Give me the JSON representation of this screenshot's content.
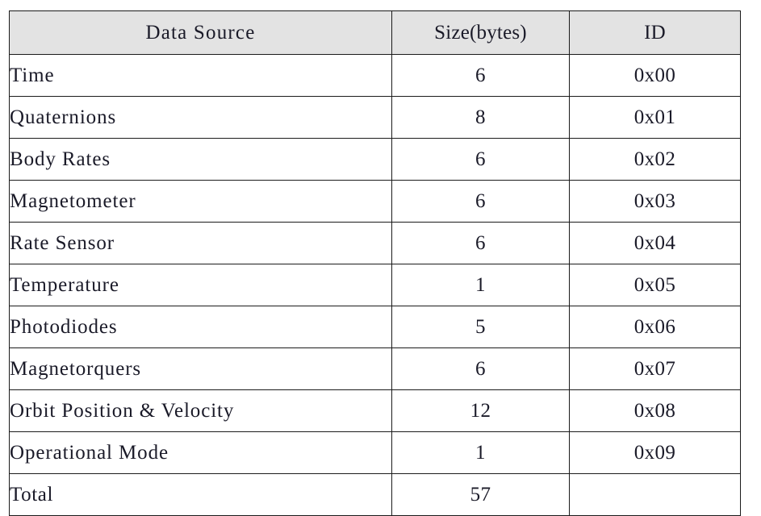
{
  "table": {
    "columns": [
      {
        "key": "source",
        "label": "Data Source"
      },
      {
        "key": "size",
        "label": "Size(bytes)"
      },
      {
        "key": "id",
        "label": "ID"
      }
    ],
    "header_background": "#e3e3e3",
    "border_color": "#1b1b1b",
    "rows": [
      {
        "source": "Time",
        "size": "6",
        "id": "0x00"
      },
      {
        "source": "Quaternions",
        "size": "8",
        "id": "0x01"
      },
      {
        "source": "Body Rates",
        "size": "6",
        "id": "0x02"
      },
      {
        "source": "Magnetometer",
        "size": "6",
        "id": "0x03"
      },
      {
        "source": "Rate Sensor",
        "size": "6",
        "id": "0x04"
      },
      {
        "source": "Temperature",
        "size": "1",
        "id": "0x05"
      },
      {
        "source": "Photodiodes",
        "size": "5",
        "id": "0x06"
      },
      {
        "source": "Magnetorquers",
        "size": "6",
        "id": "0x07"
      },
      {
        "source": "Orbit Position & Velocity",
        "size": "12",
        "id": "0x08"
      },
      {
        "source": "Operational Mode",
        "size": "1",
        "id": "0x09"
      }
    ],
    "total_row": {
      "source": "Total",
      "size": "57",
      "id": ""
    }
  }
}
